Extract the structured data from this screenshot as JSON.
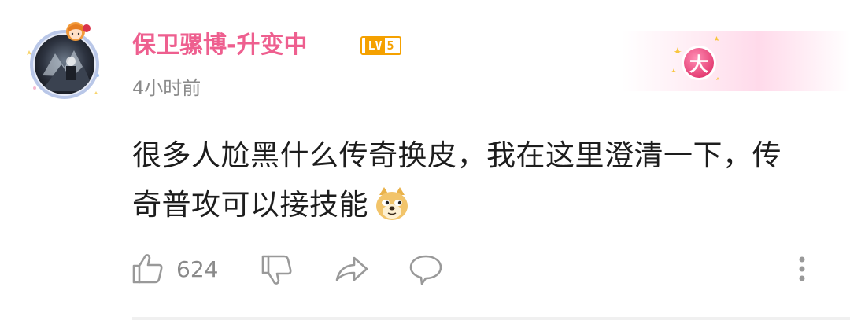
{
  "comment": {
    "username": "保卫骡博-升变中",
    "level": {
      "prefix": "LV",
      "number": "5"
    },
    "timestamp": "4小时前",
    "medal_text": "大",
    "content_line1": "很多人尬黑什么传奇换皮，我在这里澄清一下，传",
    "content_line2": "奇普攻可以接技能",
    "emoji": "doge-emoji"
  },
  "actions": {
    "like_count": "624"
  },
  "colors": {
    "username": "#ee5f8f",
    "level_badge": "#f5a100",
    "text": "#1d1d1d",
    "muted": "#8a8a8a",
    "medal": "#ef5a8c"
  }
}
